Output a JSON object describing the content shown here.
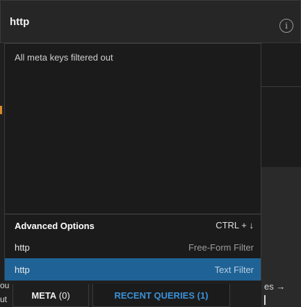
{
  "query": {
    "value": "http"
  },
  "info_icon": "info-icon",
  "meta_message": "All meta keys filtered out",
  "advanced_options": {
    "title": "Advanced Options",
    "shortcut": "CTRL + ↓",
    "items": [
      {
        "query": "http",
        "type": "Free-Form Filter",
        "selected": false
      },
      {
        "query": "http",
        "type": "Text Filter",
        "selected": true
      }
    ]
  },
  "tabs": {
    "meta_label": "META",
    "meta_count": " (0)",
    "recent_label": "RECENT QUERIES (1)"
  },
  "background": {
    "left_fragment_1": "ou",
    "left_fragment_2": "ut",
    "right_fragment": "es →"
  },
  "colors": {
    "selected_row": "#1f6396",
    "recent_tab_text": "#3a92d9",
    "accent_mark": "#d88a2a"
  }
}
